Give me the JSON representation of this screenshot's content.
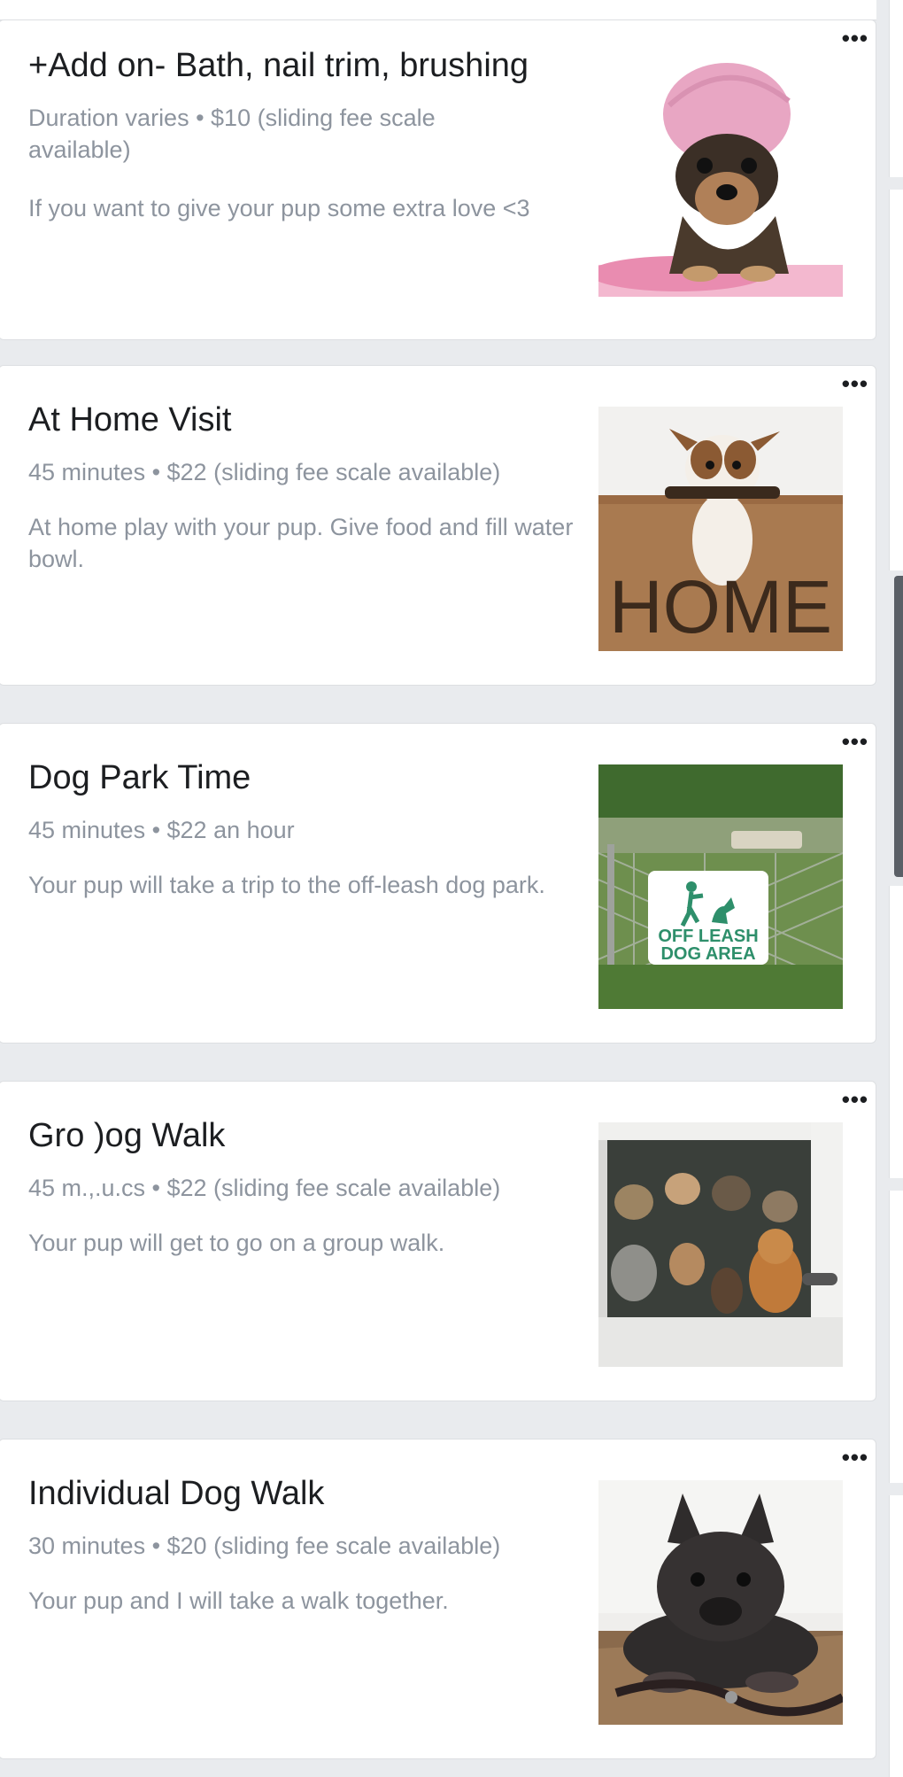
{
  "services": [
    {
      "title": "+Add on- Bath, nail trim, brushing",
      "meta": "Duration varies • $10 (sliding fee scale available)",
      "description": "If you want to give your pup some extra love <3",
      "image_icon": "dog-in-towel-image",
      "more_label": "•••"
    },
    {
      "title": "At Home Visit",
      "meta": "45 minutes • $22 (sliding fee scale available)",
      "description": "At home play with your pup. Give food and fill water bowl.",
      "image_icon": "dog-on-home-mat-image",
      "image_text": "HOME",
      "more_label": "•••"
    },
    {
      "title": "Dog Park Time",
      "meta": "45 minutes • $22 an hour",
      "description": "Your pup will take a trip to the off-leash dog park.",
      "image_icon": "off-leash-sign-image",
      "image_text_line1": "OFF LEASH",
      "image_text_line2": "DOG AREA",
      "more_label": "•••"
    },
    {
      "title": "Gro  )og Walk",
      "meta": "45 m.,.u.cs • $22 (sliding fee scale available)",
      "description": "Your pup will get to go on a group walk.",
      "image_icon": "dogs-in-van-image",
      "more_label": "•••"
    },
    {
      "title": "Individual Dog Walk",
      "meta": "30 minutes • $20 (sliding fee scale available)",
      "description": "Your pup and I will take a walk together.",
      "image_icon": "french-bulldog-with-leash-image",
      "more_label": "•••"
    }
  ]
}
